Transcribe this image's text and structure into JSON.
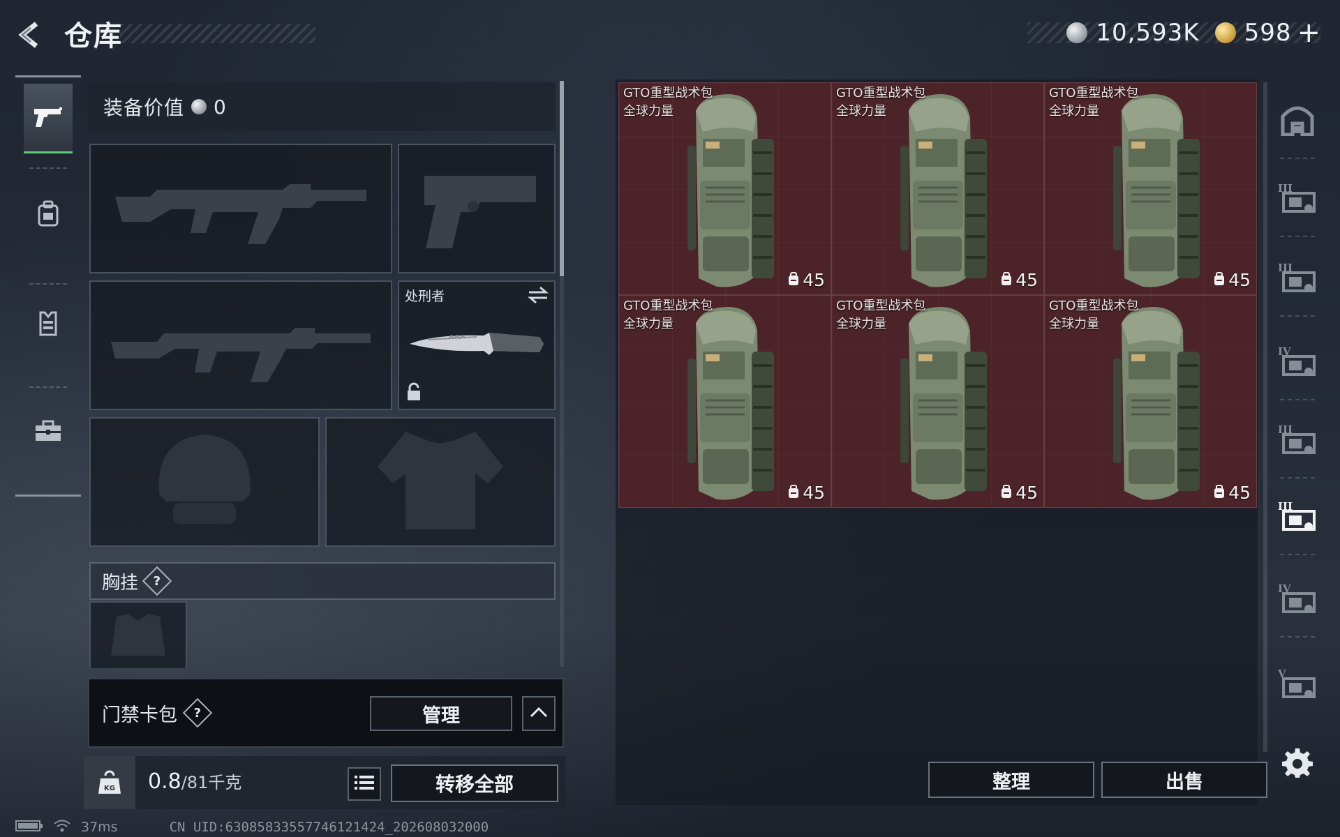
{
  "header": {
    "title": "仓库",
    "currency": [
      {
        "name": "silver-coin",
        "value": "10,593K"
      },
      {
        "name": "gold-coin",
        "value": "598"
      }
    ],
    "plus_label": "+"
  },
  "left_rail": {
    "items": [
      {
        "icon": "pistol-icon",
        "active": true
      },
      {
        "icon": "backpack-icon",
        "active": false
      },
      {
        "icon": "vest-icon",
        "active": false
      },
      {
        "icon": "toolbox-icon",
        "active": false
      }
    ]
  },
  "loadout": {
    "value_label": "装备价值",
    "value_amount": "0",
    "melee_slot_label": "处刑者",
    "chest_rig_title": "胸挂",
    "help_mark": "?",
    "keycard_title": "门禁卡包",
    "manage_label": "管理",
    "weight_current": "0.8",
    "weight_capacity": "/81千克",
    "transfer_all_label": "转移全部"
  },
  "stash": {
    "items": [
      {
        "name": "GTO重型战术包",
        "tag": "全球力量",
        "stat": "45"
      },
      {
        "name": "GTO重型战术包",
        "tag": "全球力量",
        "stat": "45"
      },
      {
        "name": "GTO重型战术包",
        "tag": "全球力量",
        "stat": "45"
      },
      {
        "name": "GTO重型战术包",
        "tag": "全球力量",
        "stat": "45"
      },
      {
        "name": "GTO重型战术包",
        "tag": "全球力量",
        "stat": "45"
      },
      {
        "name": "GTO重型战术包",
        "tag": "全球力量",
        "stat": "45"
      }
    ],
    "sort_label": "整理",
    "sell_label": "出售"
  },
  "right_rail": {
    "items": [
      {
        "icon": "stash-building-icon",
        "tier": ""
      },
      {
        "icon": "container-tier-3-icon",
        "tier": "III"
      },
      {
        "icon": "container-tier-3b-icon",
        "tier": "III"
      },
      {
        "icon": "container-tier-4-icon",
        "tier": "IV"
      },
      {
        "icon": "container-tier-3-warning-icon",
        "tier": "III"
      },
      {
        "icon": "container-tier-3-active-icon",
        "tier": "III"
      },
      {
        "icon": "container-tier-4b-icon",
        "tier": "IV"
      },
      {
        "icon": "container-tier-5-icon",
        "tier": "V"
      }
    ]
  },
  "status": {
    "ping": "37ms",
    "uid": "CN UID:630858335577461214​24_202608032000"
  },
  "colors": {
    "accent_green": "#5ec97a",
    "item_bg": "#4b2328",
    "panel_bg": "#161b23"
  }
}
